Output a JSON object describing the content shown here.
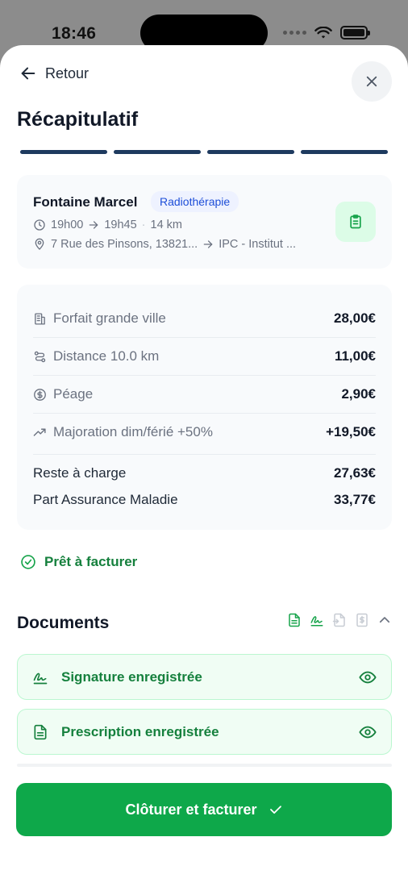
{
  "status_bar": {
    "time": "18:46"
  },
  "nav": {
    "back_label": "Retour"
  },
  "page": {
    "title": "Récapitulatif"
  },
  "progress": {
    "total_steps": 4,
    "completed_steps": 4
  },
  "patient": {
    "name": "Fontaine Marcel",
    "service": "Radiothérapie",
    "start_time": "19h00",
    "end_time": "19h45",
    "dot": "·",
    "distance": "14 km",
    "origin": "7 Rue des Pinsons, 13821...",
    "destination": "IPC - Institut ..."
  },
  "pricing": {
    "lines": [
      {
        "icon": "building-icon",
        "label": "Forfait grande ville",
        "amount": "28,00€"
      },
      {
        "icon": "route-icon",
        "label": "Distance 10.0 km",
        "amount": "11,00€"
      },
      {
        "icon": "dollar-circle-icon",
        "label": "Péage",
        "amount": "2,90€"
      },
      {
        "icon": "trending-up-icon",
        "label": "Majoration dim/férié +50%",
        "amount": "+19,50€"
      }
    ],
    "totals": [
      {
        "label": "Reste à charge",
        "amount": "27,63€"
      },
      {
        "label": "Part Assurance Maladie",
        "amount": "33,77€"
      }
    ]
  },
  "status": {
    "ready_label": "Prêt à facturer"
  },
  "documents": {
    "title": "Documents",
    "items": [
      {
        "icon": "signature-icon",
        "label": "Signature enregistrée"
      },
      {
        "icon": "file-text-icon",
        "label": "Prescription enregistrée"
      }
    ]
  },
  "cta": {
    "label": "Clôturer et facturer"
  },
  "colors": {
    "accent_green": "#0ea84a",
    "success_text": "#15803d",
    "badge_blue": "#1d4ed8",
    "progress_navy": "#1e3a5f"
  }
}
